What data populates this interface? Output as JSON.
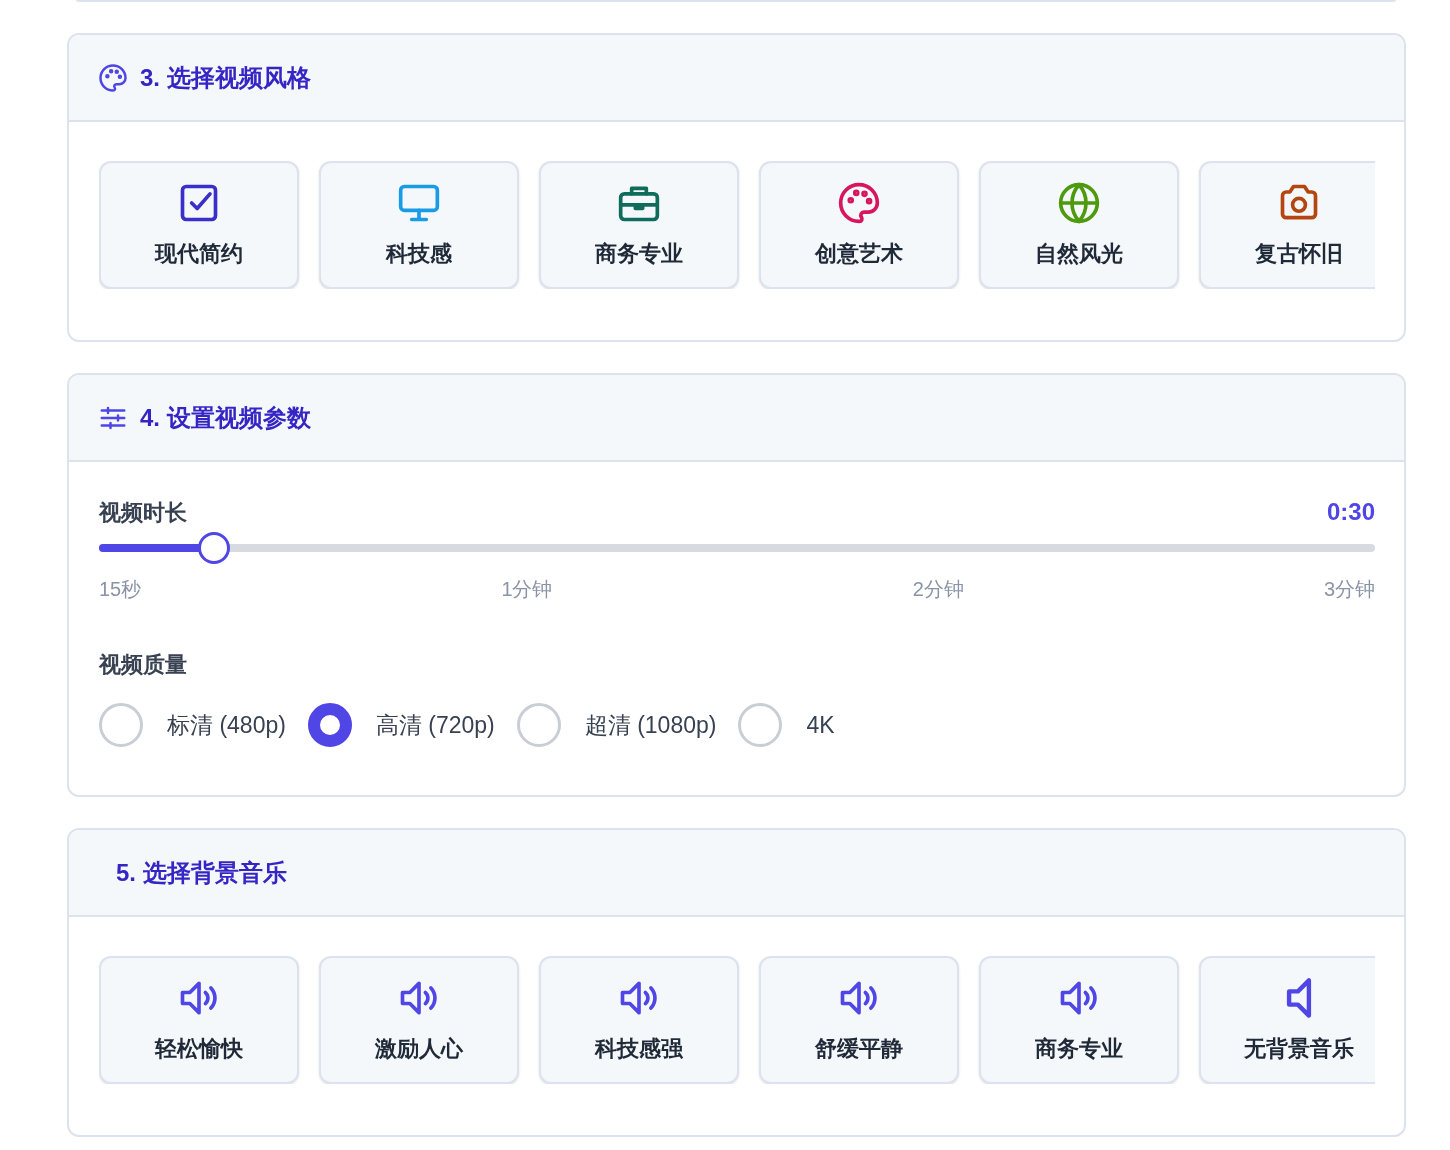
{
  "style_section": {
    "title": "3. 选择视频风格",
    "styles": [
      {
        "label": "现代简约",
        "kind": "check",
        "color": "#3b2fc9"
      },
      {
        "label": "科技感",
        "kind": "monitor",
        "color": "#1a9be6"
      },
      {
        "label": "商务专业",
        "kind": "briefcase",
        "color": "#0f6b5a"
      },
      {
        "label": "创意艺术",
        "kind": "palette",
        "color": "#d6165f"
      },
      {
        "label": "自然风光",
        "kind": "globe",
        "color": "#4d9a0c"
      },
      {
        "label": "复古怀旧",
        "kind": "camera",
        "color": "#b4460f"
      }
    ]
  },
  "params_section": {
    "title": "4. 设置视频参数",
    "duration": {
      "label": "视频时长",
      "value": "0:30",
      "level": 0.09,
      "ticks": [
        "15秒",
        "1分钟",
        "2分钟",
        "3分钟"
      ]
    },
    "quality": {
      "label": "视频质量",
      "options": [
        {
          "label": "标清 (480p)",
          "selected": false
        },
        {
          "label": "高清 (720p)",
          "selected": true
        },
        {
          "label": "超清 (1080p)",
          "selected": false
        },
        {
          "label": "4K",
          "selected": false
        }
      ]
    }
  },
  "music_section": {
    "title": "5. 选择背景音乐",
    "tracks": [
      {
        "label": "轻松愉快",
        "kind": "sound"
      },
      {
        "label": "激励人心",
        "kind": "sound"
      },
      {
        "label": "科技感强",
        "kind": "sound"
      },
      {
        "label": "舒缓平静",
        "kind": "sound"
      },
      {
        "label": "商务专业",
        "kind": "sound"
      },
      {
        "label": "无背景音乐",
        "kind": "silent"
      }
    ]
  }
}
